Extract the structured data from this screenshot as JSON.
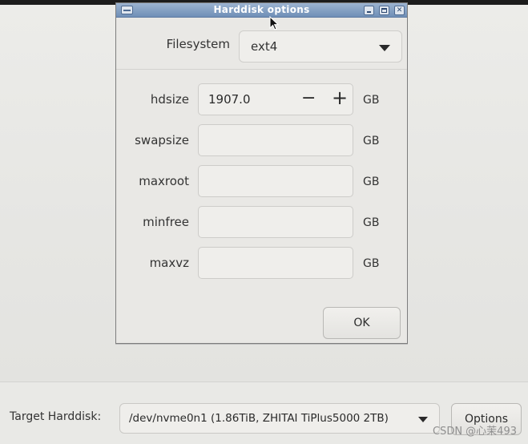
{
  "dialog": {
    "title": "Harddisk options",
    "filesystem": {
      "label": "Filesystem",
      "value": "ext4"
    },
    "fields": [
      {
        "label": "hdsize",
        "value": "1907.0",
        "unit": "GB"
      },
      {
        "label": "swapsize",
        "value": "",
        "unit": "GB"
      },
      {
        "label": "maxroot",
        "value": "",
        "unit": "GB"
      },
      {
        "label": "minfree",
        "value": "",
        "unit": "GB"
      },
      {
        "label": "maxvz",
        "value": "",
        "unit": "GB"
      }
    ],
    "stepper": {
      "minus": "−",
      "plus": "+"
    },
    "ok_label": "OK"
  },
  "bottom": {
    "target_label": "Target Harddisk:",
    "harddisk_value": "/dev/nvme0n1 (1.86TiB, ZHITAI TiPlus5000 2TB)",
    "options_label": "Options"
  },
  "watermark": "CSDN @心茉493",
  "icons": {
    "window_menu": "window-menu-icon",
    "minimize": "minimize-icon",
    "maximize": "maximize-icon",
    "close": "close-icon",
    "combo_arrow": "chevron-down-icon",
    "cursor": "mouse-pointer-icon"
  }
}
